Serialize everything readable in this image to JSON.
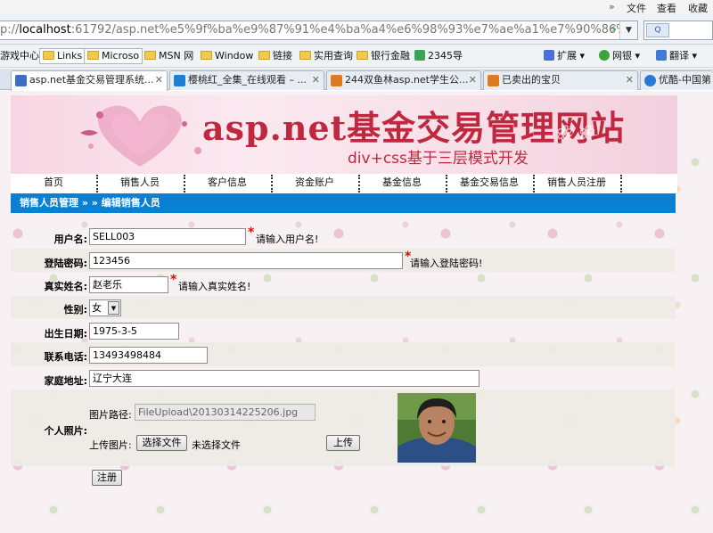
{
  "browser": {
    "menu": [
      "文件",
      "查看",
      "收藏"
    ],
    "address_prefix": "p://",
    "address_host": "localhost",
    "address_rest": ":61792/asp.net%e5%9f%ba%e9%87%91%e4%ba%a4%e6%98%93%e7%ae%a1%e7%90%86%e",
    "search_engine": "Q",
    "favorites": [
      "游戏中心",
      "Links",
      "Microso",
      "MSN 网",
      "Window",
      "链接",
      "实用查询",
      "银行金融",
      "2345导"
    ],
    "extensions": [
      "扩展",
      "网银",
      "翻译"
    ],
    "tabs": [
      {
        "label": "asp.net基金交易管理系统...",
        "icon_color": "#3a6fc4"
      },
      {
        "label": "樱桃红_全集_在线观看 – ...",
        "icon_color": "#1d7fd6"
      },
      {
        "label": "244双鱼林asp.net学生公...",
        "icon_color": "#e07a1f"
      },
      {
        "label": "已卖出的宝贝",
        "icon_color": "#e07a1f"
      },
      {
        "label": "优酷-中国第",
        "icon_color": "#2a79d8"
      }
    ]
  },
  "site": {
    "title": "asp.net基金交易管理网站",
    "subtitle": "div+css基于三层模式开发",
    "nav": [
      "首页",
      "销售人员",
      "客户信息",
      "资金账户",
      "基金信息",
      "基金交易信息",
      "销售人员注册"
    ],
    "breadcrumb": "销售人员管理 » » 编辑销售人员"
  },
  "form": {
    "username_label": "用户名:",
    "username_value": "SELL003",
    "username_hint": "请输入用户名!",
    "password_label": "登陆密码:",
    "password_value": "123456",
    "password_hint": "请输入登陆密码!",
    "realname_label": "真实姓名:",
    "realname_value": "赵老乐",
    "realname_hint": "请输入真实姓名!",
    "gender_label": "性别:",
    "gender_value": "女",
    "birth_label": "出生日期:",
    "birth_value": "1975-3-5",
    "phone_label": "联系电话:",
    "phone_value": "13493498484",
    "address_label": "家庭地址:",
    "address_value": "辽宁大连",
    "photo_label": "个人照片:",
    "photo_path_label": "图片路径:",
    "photo_path_value": "FileUpload\\20130314225206.jpg",
    "upload_label": "上传图片:",
    "choose_file_button": "选择文件",
    "no_file_text": "未选择文件",
    "upload_button": "上传",
    "submit_button": "注册",
    "required_mark": "*"
  }
}
